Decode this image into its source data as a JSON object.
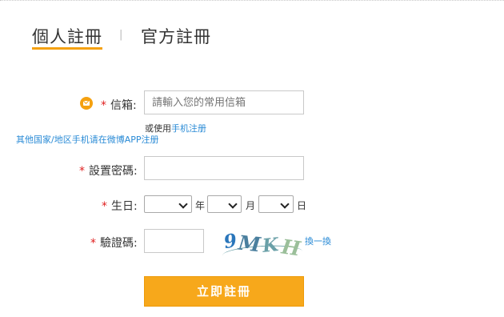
{
  "tabs": {
    "personal": "個人註冊",
    "separator": "|",
    "official": "官方註冊"
  },
  "form": {
    "email_label": "信箱:",
    "email_placeholder": "請輸入您的常用信箱",
    "alt_prefix": "或使用",
    "alt_link": "手机注册",
    "other_region_link": "其他国家/地区手机请在微博APP注册",
    "password_label": "設置密碼:",
    "birthday_label": "生日:",
    "year_unit": "年",
    "month_unit": "月",
    "day_unit": "日",
    "captcha_label": "驗證碼:",
    "captcha_chars": [
      "9",
      "M",
      "K",
      "H"
    ],
    "refresh_link": "換一換",
    "required_mark": "*"
  },
  "submit_label": "立即註冊",
  "colors": {
    "accent": "#f5a110",
    "link": "#2a8bd6",
    "required": "#e02020"
  }
}
